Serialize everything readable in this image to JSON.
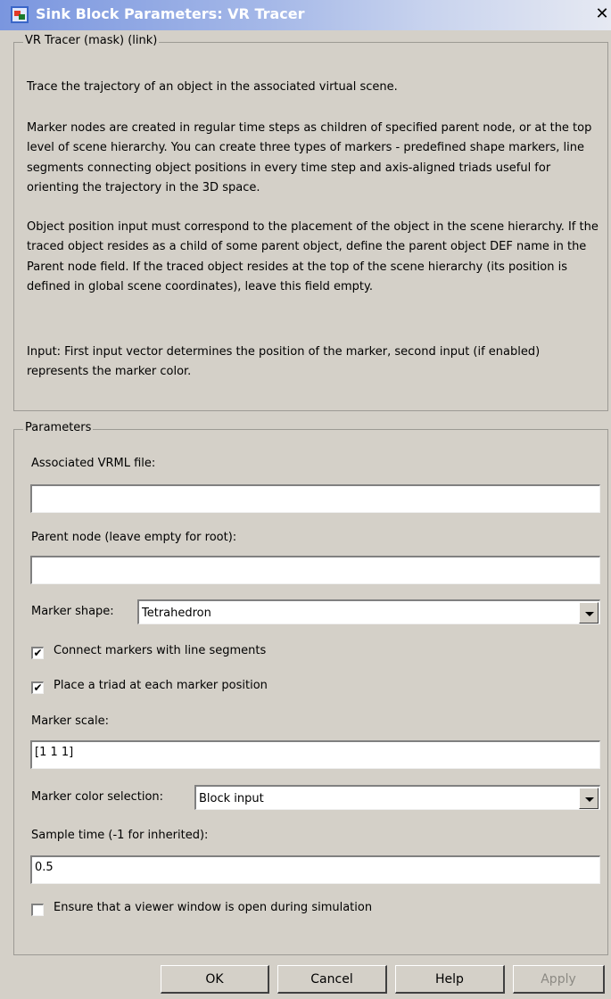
{
  "window": {
    "title": "Sink Block Parameters: VR Tracer",
    "close_glyph": "✕"
  },
  "description_group": {
    "legend": "VR Tracer (mask) (link)",
    "paragraphs": [
      "Trace the trajectory of an object in the associated virtual scene.",
      "Marker nodes are created in regular time steps as children of specified parent node, or at the top level of scene hierarchy. You can create three types of markers - predefined shape markers, line segments connecting object positions in every time step and axis-aligned triads useful for orienting the trajectory in the 3D space.",
      "Object position input must correspond to the placement of the object in the scene hierarchy. If the traced object resides as a child of some parent object, define the parent object DEF name in the Parent node field. If the traced object resides at the top of the scene hierarchy (its position is defined in global scene coordinates), leave this field empty.",
      "Input: First input vector determines the position of the marker, second input (if enabled) represents the marker color."
    ]
  },
  "parameters_group": {
    "legend": "Parameters",
    "vrml_file": {
      "label": "Associated VRML file:",
      "value": ""
    },
    "parent_node": {
      "label": "Parent node (leave empty for root):",
      "value": ""
    },
    "marker_shape": {
      "label": "Marker shape:",
      "value": "Tetrahedron"
    },
    "connect_markers": {
      "label": "Connect markers with line segments",
      "checked": true
    },
    "place_triad": {
      "label": "Place a triad at each marker position",
      "checked": true
    },
    "marker_scale": {
      "label": "Marker scale:",
      "value": "[1 1 1]"
    },
    "marker_color": {
      "label": "Marker color selection:",
      "value": "Block input"
    },
    "sample_time": {
      "label": "Sample time (-1 for inherited):",
      "value": "0.5"
    },
    "ensure_viewer": {
      "label": "Ensure that a viewer window is open during simulation",
      "checked": false
    }
  },
  "buttons": {
    "ok": "OK",
    "cancel": "Cancel",
    "help": "Help",
    "apply": "Apply"
  },
  "icons": {
    "app_icon": "simulink-block-icon",
    "close": "close-icon",
    "dropdown": "chevron-down-icon",
    "check": "✔"
  }
}
